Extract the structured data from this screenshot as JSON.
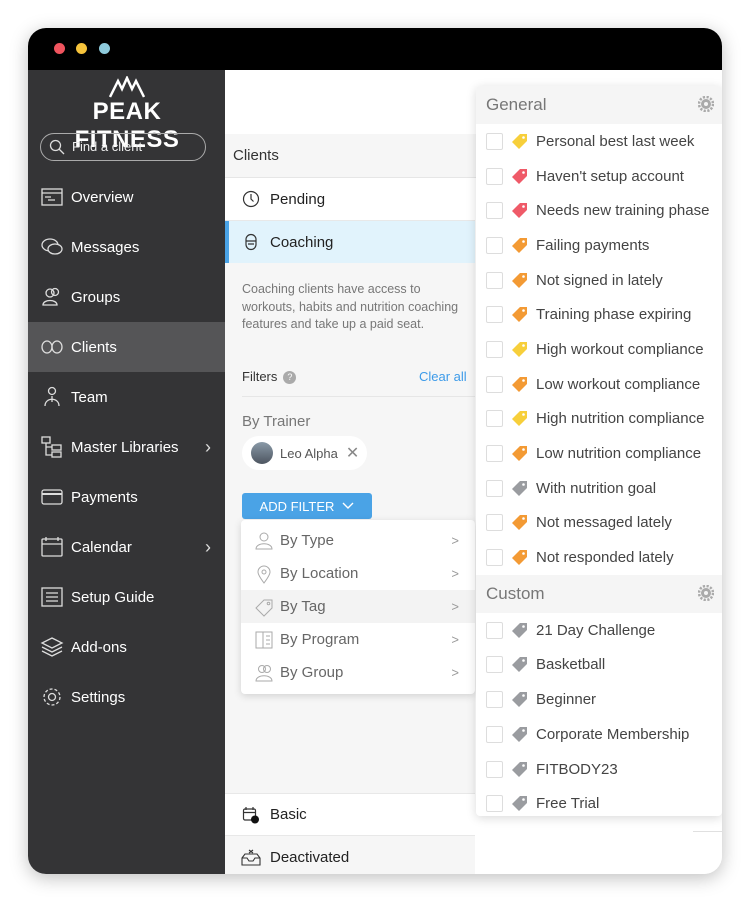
{
  "window": {
    "dots": [
      "#f0545e",
      "#f6c33b",
      "#8ecbdc"
    ]
  },
  "sidebar": {
    "brand": "PEAK FITNESS",
    "search_placeholder": "Find a client",
    "items": [
      {
        "label": "Overview",
        "icon": "overview-icon"
      },
      {
        "label": "Messages",
        "icon": "messages-icon"
      },
      {
        "label": "Groups",
        "icon": "groups-icon"
      },
      {
        "label": "Clients",
        "icon": "clients-icon",
        "active": true
      },
      {
        "label": "Team",
        "icon": "team-icon"
      },
      {
        "label": "Master Libraries",
        "icon": "libraries-icon",
        "has_submenu": true
      },
      {
        "label": "Payments",
        "icon": "payments-icon"
      },
      {
        "label": "Calendar",
        "icon": "calendar-icon",
        "has_submenu": true
      },
      {
        "label": "Setup Guide",
        "icon": "setup-guide-icon"
      },
      {
        "label": "Add-ons",
        "icon": "addons-icon"
      },
      {
        "label": "Settings",
        "icon": "settings-icon"
      }
    ]
  },
  "clients": {
    "header": "Clients",
    "segments": {
      "pending": "Pending",
      "coaching": "Coaching",
      "basic": "Basic",
      "deactivated": "Deactivated"
    },
    "description": "Coaching clients have access to workouts, habits and nutrition coaching features and take up a paid seat.",
    "filters_label": "Filters",
    "help": "?",
    "clear_all": "Clear all",
    "by_trainer": "By Trainer",
    "trainer_chip": "Leo Alpha",
    "add_filter": "ADD FILTER",
    "filter_menu": [
      "By Type",
      "By Location",
      "By Tag",
      "By Program",
      "By Group"
    ]
  },
  "tags": {
    "colors": {
      "yellow": "#f7cf3b",
      "red": "#ef5a68",
      "orange": "#f39a34",
      "gray": "#9a9ca0"
    },
    "general_title": "General",
    "general": [
      {
        "label": "Personal best last week",
        "color": "yellow"
      },
      {
        "label": "Haven't setup account",
        "color": "red"
      },
      {
        "label": "Needs new training phase",
        "color": "red"
      },
      {
        "label": "Failing payments",
        "color": "orange"
      },
      {
        "label": "Not signed in lately",
        "color": "orange"
      },
      {
        "label": "Training phase expiring",
        "color": "orange"
      },
      {
        "label": "High workout compliance",
        "color": "yellow"
      },
      {
        "label": "Low workout compliance",
        "color": "orange"
      },
      {
        "label": "High nutrition compliance",
        "color": "yellow"
      },
      {
        "label": "Low nutrition compliance",
        "color": "orange"
      },
      {
        "label": "With nutrition goal",
        "color": "gray"
      },
      {
        "label": "Not messaged lately",
        "color": "orange"
      },
      {
        "label": "Not responded lately",
        "color": "orange"
      }
    ],
    "custom_title": "Custom",
    "custom": [
      {
        "label": "21 Day Challenge",
        "color": "gray"
      },
      {
        "label": "Basketball",
        "color": "gray"
      },
      {
        "label": "Beginner",
        "color": "gray"
      },
      {
        "label": "Corporate Membership",
        "color": "gray"
      },
      {
        "label": "FITBODY23",
        "color": "gray"
      },
      {
        "label": "Free Trial",
        "color": "gray"
      }
    ]
  }
}
